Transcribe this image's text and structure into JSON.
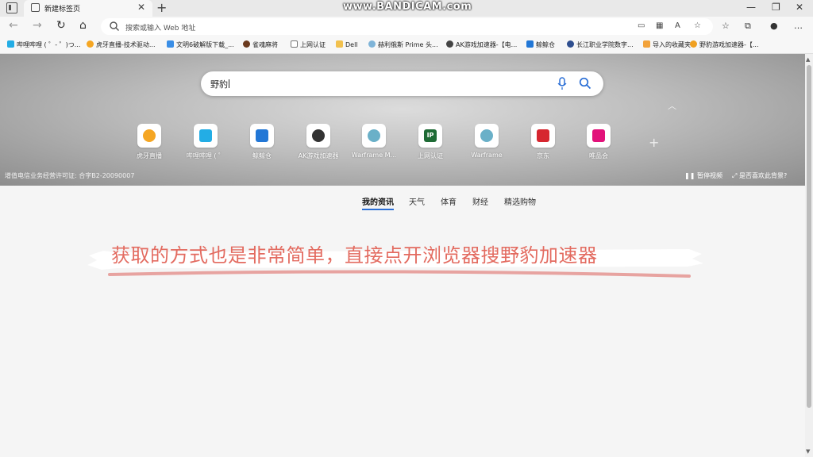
{
  "watermark": "www.BANDICAM.com",
  "tab": {
    "title": "新建标签页"
  },
  "address": {
    "placeholder": "搜索或输入 Web 地址"
  },
  "bookmarks": [
    "哔哩哔哩 ( ゜- ゜)つ...",
    "虎牙直播-技术驱动...",
    "文明6破解版下载_...",
    "雀魂麻将",
    "上网认证",
    "Dell",
    "赫利俄斯 Prime 头...",
    "AK游戏加速器-【电...",
    "鲸鲸仓",
    "长江职业学院数字...",
    "导入的收藏夹",
    "野豹游戏加速器-【..."
  ],
  "search": {
    "query": "野豹"
  },
  "tiles": [
    {
      "label": "虎牙直播",
      "color": "#f5a623"
    },
    {
      "label": "哔哩哔哩 ( ゜",
      "color": "#23ade5"
    },
    {
      "label": "鲸鲸仓",
      "color": "#2277d6"
    },
    {
      "label": "AK游戏加速器",
      "color": "#333333"
    },
    {
      "label": "Warframe M...",
      "color": "#6ab0c8"
    },
    {
      "label": "上网认证",
      "color": "#1e6b35"
    },
    {
      "label": "Warframe",
      "color": "#6ab0c8"
    },
    {
      "label": "京东",
      "color": "#d6262f"
    },
    {
      "label": "唯品会",
      "color": "#e2127a"
    }
  ],
  "tile_glyphs": {
    "ip": "IP"
  },
  "icp": "增值电信业务经营许可证: 合字B2-20090007",
  "hero_links": {
    "video": "暂停视频",
    "like": "是否喜欢此背景?"
  },
  "news_tabs": [
    "我的资讯",
    "天气",
    "体育",
    "财经",
    "精选购物"
  ],
  "caption": "获取的方式也是非常简单，直接点开浏览器搜野豹加速器",
  "colors": {
    "accent": "#2b6fd6",
    "caption": "#e36b60"
  }
}
